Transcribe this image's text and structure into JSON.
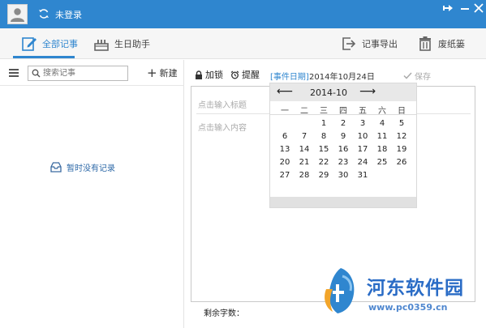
{
  "header": {
    "login_status": "未登录"
  },
  "toolbar": {
    "all_notes": "全部记事",
    "birthday_helper": "生日助手",
    "export_notes": "记事导出",
    "recycle_bin": "废纸篓"
  },
  "left_panel": {
    "search_placeholder": "搜索记事",
    "new_button": "新建",
    "empty_message": "暂时没有记录"
  },
  "editor": {
    "lock_label": "加锁",
    "remind_label": "提醒",
    "event_date_tag": "[事件日期]",
    "event_date": "2014年10月24日",
    "save_label": "保存",
    "title_placeholder": "点击输入标题",
    "content_placeholder": "点击输入内容",
    "word_count_label": "剩余字数："
  },
  "calendar": {
    "prev": "⟵",
    "next": "⟶",
    "month_title": "2014-10",
    "weekdays": [
      "一",
      "二",
      "三",
      "四",
      "五",
      "六",
      "日"
    ],
    "days": [
      [
        "",
        "",
        "1",
        "2",
        "3",
        "4",
        "5"
      ],
      [
        "6",
        "7",
        "8",
        "9",
        "10",
        "11",
        "12"
      ],
      [
        "13",
        "14",
        "15",
        "16",
        "17",
        "18",
        "19"
      ],
      [
        "20",
        "21",
        "22",
        "23",
        "24",
        "25",
        "26"
      ],
      [
        "27",
        "28",
        "29",
        "30",
        "31",
        "",
        ""
      ]
    ]
  },
  "watermark": {
    "title": "河东软件园",
    "url": "www.pc0359.cn"
  },
  "colors": {
    "accent": "#2f86cf",
    "watermark": "#2a6cc6"
  }
}
